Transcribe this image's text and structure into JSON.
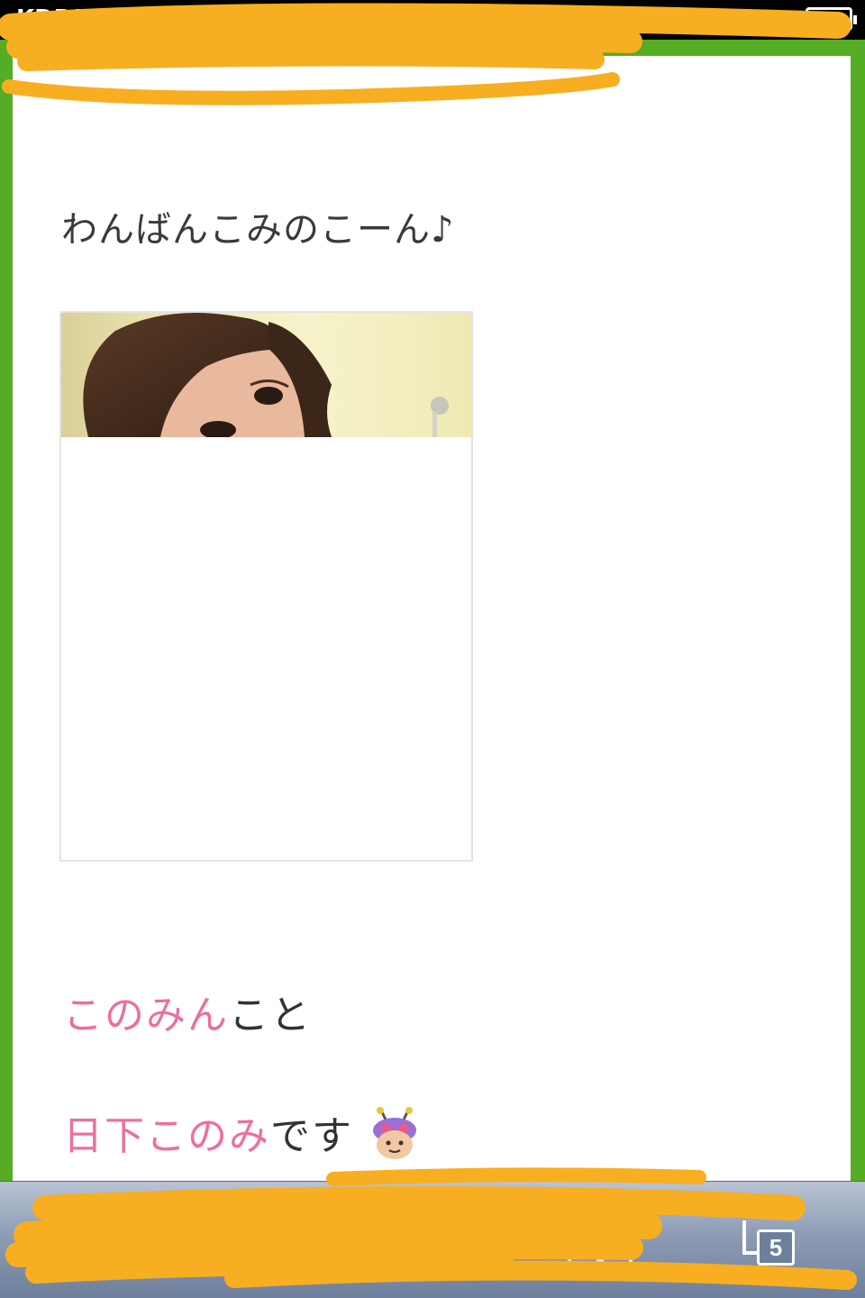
{
  "status_bar": {
    "carrier": "KDDI"
  },
  "post": {
    "greeting": "わんばんこみのこーん♪",
    "line1_highlight": "このみん",
    "line1_rest": "こと",
    "line2_highlight": "日下このみ",
    "line2_rest": "です"
  },
  "toolbar": {
    "tab_count": "5"
  },
  "colors": {
    "frame_green": "#55ad24",
    "highlight_pink": "#ec6fa0",
    "redaction_orange": "#f7ae21",
    "toolbar_blue": "#8e9db5"
  }
}
